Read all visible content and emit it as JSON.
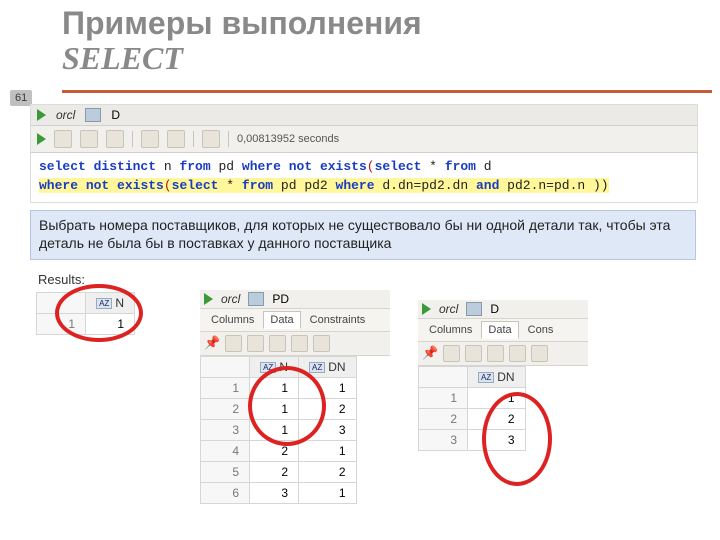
{
  "page_number": "61",
  "title_line1": "Примеры выполнения",
  "title_line2": "SELECT",
  "ide": {
    "conn_tab": "orcl",
    "table_tab": "D",
    "exec_time": "0,00813952 seconds",
    "sql": {
      "l1": {
        "t1": "select",
        "t2": " ",
        "t3": "distinct",
        "t4": " n ",
        "t5": "from",
        "t6": " pd ",
        "t7": "where",
        "t8": " ",
        "t9": "not",
        "t10": " ",
        "t11": "exists",
        "t12": "(",
        "t13": "select",
        "t14": " * ",
        "t15": "from",
        "t16": " d"
      },
      "l2": {
        "t1": "where",
        "t2": " ",
        "t3": "not",
        "t4": " ",
        "t5": "exists",
        "t6": "(",
        "t7": "select",
        "t8": " * ",
        "t9": "from",
        "t10": " pd pd2 ",
        "t11": "where",
        "t12": " d.dn=pd2.dn ",
        "t13": "and",
        "t14": " pd2.n=pd.n ))"
      }
    }
  },
  "explain": "Выбрать номера поставщиков, для которых не существовало бы ни одной детали так, чтобы эта деталь не была бы в поставках у данного поставщика",
  "results_label": "Results:",
  "result_grid": {
    "headers": [
      "",
      "N"
    ],
    "rows": [
      [
        "1",
        "1"
      ]
    ]
  },
  "pd_panel": {
    "conn": "orcl",
    "table": "PD",
    "subtabs": [
      "Columns",
      "Data",
      "Constraints"
    ],
    "headers": [
      "",
      "N",
      "DN"
    ],
    "rows": [
      [
        "1",
        "1",
        "1"
      ],
      [
        "2",
        "1",
        "2"
      ],
      [
        "3",
        "1",
        "3"
      ],
      [
        "4",
        "2",
        "1"
      ],
      [
        "5",
        "2",
        "2"
      ],
      [
        "6",
        "3",
        "1"
      ]
    ]
  },
  "d_panel": {
    "conn": "orcl",
    "table": "D",
    "subtabs": [
      "Columns",
      "Data",
      "Cons"
    ],
    "headers": [
      "",
      "DN"
    ],
    "rows": [
      [
        "1",
        "1"
      ],
      [
        "2",
        "2"
      ],
      [
        "3",
        "3"
      ]
    ]
  }
}
